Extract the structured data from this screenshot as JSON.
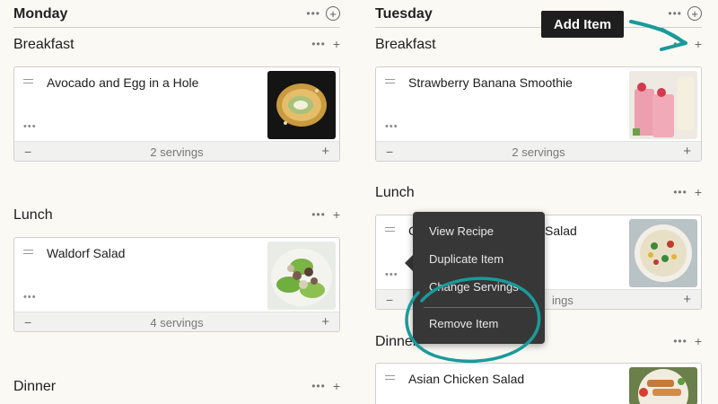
{
  "accent_color": "#1a9a9a",
  "monday": {
    "title": "Monday",
    "meals": {
      "breakfast": {
        "title": "Breakfast",
        "recipe": "Avocado and Egg in a Hole",
        "servings": "2 servings"
      },
      "lunch": {
        "title": "Lunch",
        "recipe": "Waldorf Salad",
        "servings": "4 servings"
      },
      "dinner": {
        "title": "Dinner"
      }
    }
  },
  "tuesday": {
    "title": "Tuesday",
    "meals": {
      "breakfast": {
        "title": "Breakfast",
        "recipe": "Strawberry Banana Smoothie",
        "servings": "2 servings"
      },
      "lunch": {
        "title": "Lunch",
        "recipe_visible_start": "C",
        "recipe_visible_end": "Salad",
        "servings_visible": "ings"
      },
      "dinner": {
        "title": "Dinner",
        "recipe": "Asian Chicken Salad"
      }
    }
  },
  "context_menu": {
    "items": [
      "View Recipe",
      "Duplicate Item",
      "Change Servings"
    ],
    "remove": "Remove Item"
  },
  "annotation": {
    "callout": "Add Item"
  },
  "icons": {
    "more": "dots-icon",
    "add_day": "plus-circle-icon",
    "add_meal": "plus-icon",
    "drag": "drag-handle-icon",
    "decrease": "minus-icon",
    "increase": "plus-icon"
  }
}
